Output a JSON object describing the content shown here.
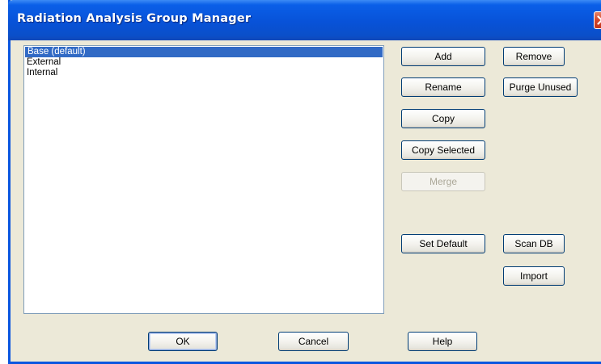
{
  "window": {
    "title": "Radiation Analysis Group Manager"
  },
  "list": {
    "items": [
      {
        "label": "Base (default)",
        "selected": true
      },
      {
        "label": "External",
        "selected": false
      },
      {
        "label": "Internal",
        "selected": false
      }
    ]
  },
  "buttons": {
    "add": "Add",
    "remove": "Remove",
    "rename": "Rename",
    "purge_unused": "Purge Unused",
    "copy": "Copy",
    "copy_selected": "Copy Selected",
    "merge": "Merge",
    "set_default": "Set Default",
    "scan_db": "Scan DB",
    "import": "Import"
  },
  "footer": {
    "ok": "OK",
    "cancel": "Cancel",
    "help": "Help"
  },
  "colors": {
    "titlebar": "#0852d8",
    "dialog_bg": "#ece9d8",
    "selection": "#316ac5",
    "close_button": "#d3452a"
  },
  "icons": {
    "close": "close-icon"
  }
}
